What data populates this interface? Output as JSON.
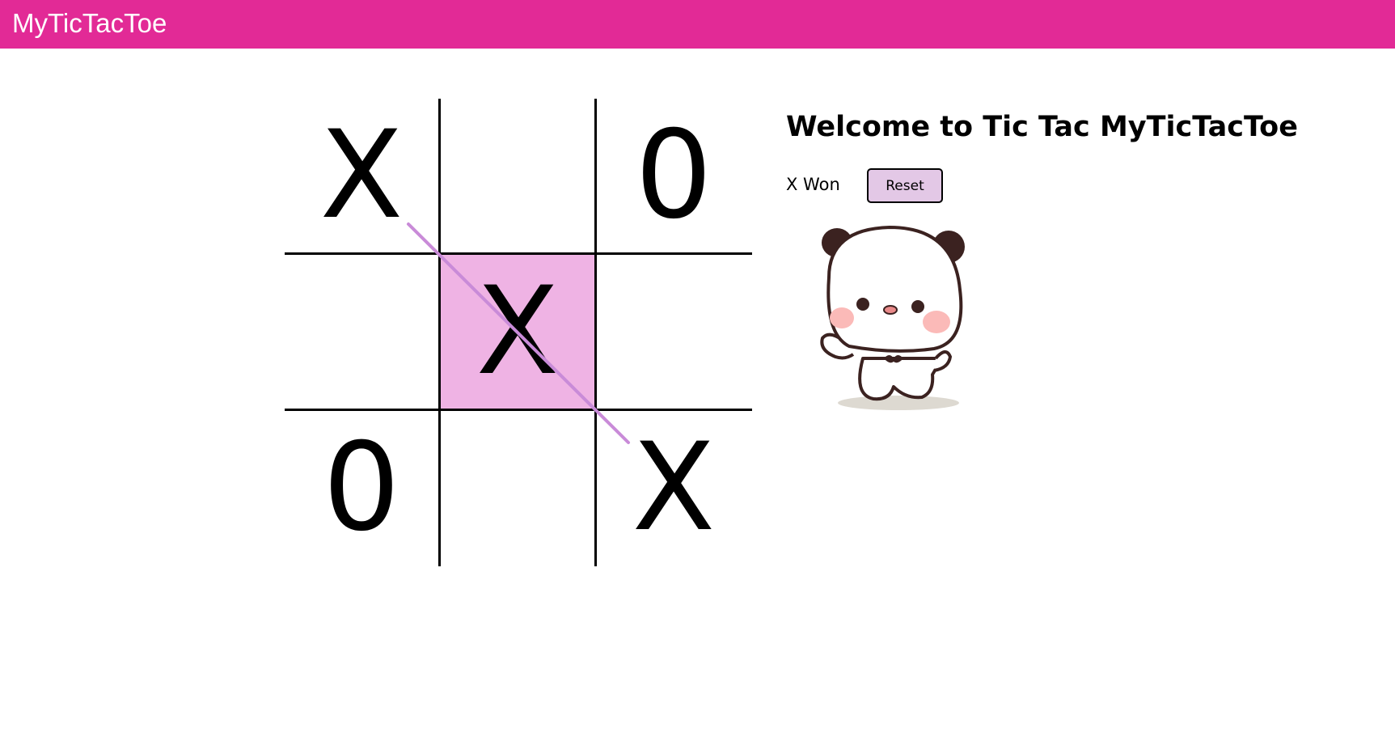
{
  "app": {
    "title": "MyTicTacToe",
    "brand_color": "#e22a96"
  },
  "board": {
    "cells": [
      "X",
      "",
      "0",
      "",
      "X",
      "",
      "0",
      "",
      "X"
    ],
    "winning_cells": [
      0,
      4,
      8
    ],
    "highlight_color": "#efb3e4",
    "strike_color": "#c98bd8"
  },
  "panel": {
    "welcome": "Welcome to Tic Tac MyTicTacToe",
    "status": "X Won",
    "reset_label": "Reset",
    "reset_color": "#e3c8e6"
  },
  "mascot": {
    "icon": "panda-mascot-icon"
  }
}
